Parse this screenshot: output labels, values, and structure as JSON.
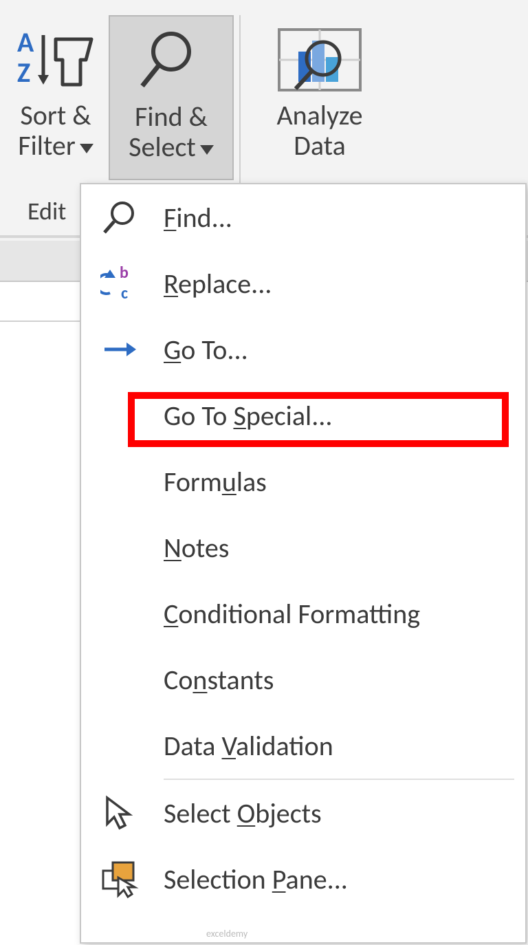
{
  "ribbon": {
    "sort_filter_label_1": "Sort &",
    "sort_filter_label_2": "Filter",
    "find_select_label_1": "Find &",
    "find_select_label_2": "Select",
    "analyze_label_1": "Analyze",
    "analyze_label_2": "Data",
    "editing_group": "Edit"
  },
  "menu": {
    "find": "Find...",
    "replace": "Replace...",
    "goto": "Go To...",
    "goto_special": "Go To Special...",
    "formulas": "Formulas",
    "notes": "Notes",
    "cond_format": "Conditional Formatting",
    "constants": "Constants",
    "data_validation": "Data Validation",
    "select_objects": "Select Objects",
    "selection_pane": "Selection Pane..."
  },
  "watermark": "exceldemy"
}
